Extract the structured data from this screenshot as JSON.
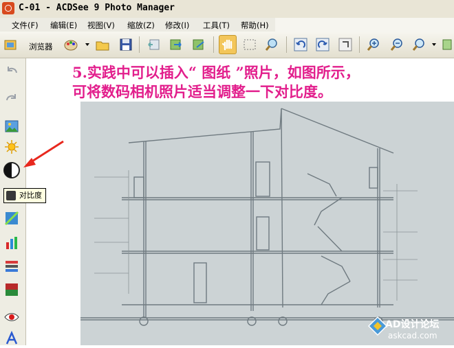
{
  "window": {
    "title": "C-01 - ACDSee 9 Photo Manager"
  },
  "menu": {
    "items": [
      "文件(F)",
      "编辑(E)",
      "视图(V)",
      "缩放(Z)",
      "修改(I)",
      "工具(T)",
      "帮助(H)"
    ]
  },
  "toolbar": {
    "browser_label": "浏览器"
  },
  "caption": {
    "line1": "5.实践中可以插入“ 图纸 ”照片，如图所示，",
    "line2": "可将数码相机照片适当调整一下对比度。"
  },
  "tooltip": {
    "label": "对比度"
  },
  "watermark": {
    "line1": "AD设计论坛",
    "line2": "askcad.com"
  },
  "colors": {
    "caption": "#e21e8c",
    "arrow": "#e8281e",
    "selected_tool": "#f3c65a"
  }
}
